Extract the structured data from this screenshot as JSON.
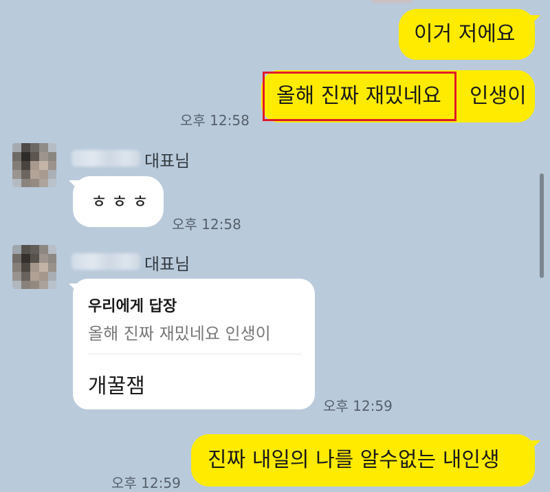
{
  "colors": {
    "background": "#b9cadb",
    "my_bubble": "#ffeb00",
    "their_bubble": "#ffffff",
    "highlight_border": "#e0182b"
  },
  "messages": [
    {
      "sender": "me",
      "text": "이거 저에요"
    },
    {
      "sender": "me",
      "highlighted_text": "올해 진짜 재밌네요",
      "rest_text": "인생이",
      "time": "오후 12:58"
    },
    {
      "sender": "them",
      "name_suffix": "대표님",
      "text": "ㅎㅎㅎ",
      "time": "오후 12:58"
    },
    {
      "sender": "them",
      "name_suffix": "대표님",
      "reply_title": "우리에게 답장",
      "reply_quote": "올해 진짜 재밌네요 인생이",
      "text": "개꿀잼",
      "time": "오후 12:59"
    },
    {
      "sender": "me",
      "text": "진짜 내일의 나를 알수없는 내인생",
      "time": "오후 12:59"
    }
  ]
}
